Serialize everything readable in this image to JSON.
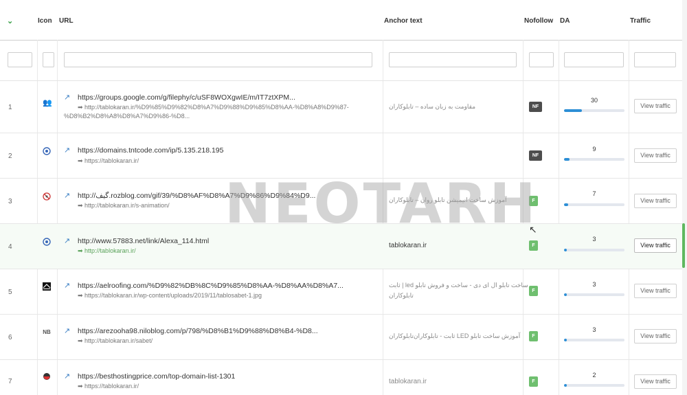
{
  "header": {
    "icon": "Icon",
    "url": "URL",
    "anchor": "Anchor text",
    "nofollow": "Nofollow",
    "da": "DA",
    "traffic": "Traffic"
  },
  "icons": {
    "collapse": "chevron-down-icon",
    "external": "external-link-icon"
  },
  "colors": {
    "accent": "#3fa34d",
    "nf_badge": "#4d4d4d",
    "f_badge": "#6fbf6f",
    "da_bar": "#2d8fd6"
  },
  "rows": [
    {
      "num": "1",
      "icon": "users-icon",
      "url": "https://groups.google.com/g/filephy/c/uSF8WOXgwIE/m/IT7ztXPM...",
      "target1": "➡ http://tablokaran.ir/%D9%85%D9%82%D8%A7%D9%88%D9%85%D8%AA-%D8%A8%D9%87-",
      "target2": "%D8%B2%D8%A8%D8%A7%D9%86-%D8...",
      "anchor": "مقاومت به زبان ساده – تابلوکاران",
      "nofollow": "NF",
      "da": 30,
      "da_pct": 0.3,
      "traffic": "View traffic"
    },
    {
      "num": "2",
      "icon": "globe-icon",
      "url": "https://domains.tntcode.com/ip/5.135.218.195",
      "target1": "➡ https://tablokaran.ir/",
      "anchor": "",
      "nofollow": "NF",
      "da": 9,
      "da_pct": 0.09,
      "traffic": "View traffic"
    },
    {
      "num": "3",
      "icon": "blocked-icon",
      "url": "http://گیف.rozblog.com/gif/39/%D8%AF%D8%A7%D9%86%D9%84%D9...",
      "target1": "➡ http://tablokaran.ir/s-animation/",
      "anchor": "آموزش ساخت انیمیشن تابلو روان – تابلوکاران",
      "nofollow": "F",
      "da": 7,
      "da_pct": 0.07,
      "traffic": "View traffic"
    },
    {
      "num": "4",
      "icon": "globe-icon",
      "url": "http://www.57883.net/link/Alexa_114.html",
      "target1": "➡ http://tablokaran.ir/",
      "anchor": "tablokaran.ir",
      "nofollow": "F",
      "da": 3,
      "da_pct": 0.03,
      "traffic": "View traffic"
    },
    {
      "num": "5",
      "icon": "site-favicon-icon",
      "url": "https://aelroofing.com/%D9%82%DB%8C%D9%85%D8%AA-%D8%AA%D8%A7...",
      "target1": "➡ https://tablokaran.ir/wp-content/uploads/2019/11/tablosabet-1.jpg",
      "anchor": "ثابت | led ساخت تابلو ال ای دی - ساخت و فروش تابلو",
      "anchor2": "تابلوکاران",
      "nofollow": "F",
      "da": 3,
      "da_pct": 0.03,
      "traffic": "View traffic"
    },
    {
      "num": "6",
      "icon": "nb-icon",
      "icon_text": "NB",
      "url": "https://arezooha98.niloblog.com/p/798/%D8%B1%D9%88%D8%B4-%D8...",
      "target1": "➡ http://tablokaran.ir/sabet/",
      "anchor": "ثابت - تابلوکاران‌تابلوکاران LED آموزش ساخت تابلو",
      "nofollow": "F",
      "da": 3,
      "da_pct": 0.03,
      "traffic": "View traffic"
    },
    {
      "num": "7",
      "icon": "site-favicon-icon",
      "url": "https://besthostingprice.com/top-domain-list-1301",
      "target1": "➡ https://tablokaran.ir/",
      "anchor": "tablokaran.ir",
      "nofollow": "F",
      "da": 2,
      "da_pct": 0.02,
      "traffic": "View traffic"
    }
  ],
  "watermark": "NEOTARH"
}
